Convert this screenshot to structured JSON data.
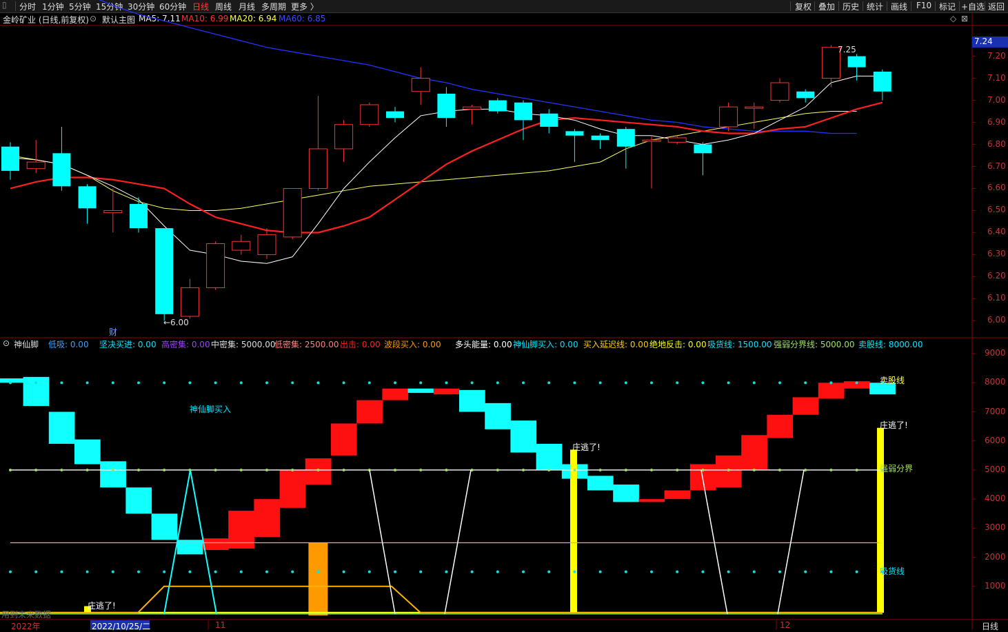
{
  "toolbar": {
    "periods": [
      "分时",
      "1分钟",
      "5分钟",
      "15分钟",
      "30分钟",
      "60分钟",
      "日线",
      "周线",
      "月线",
      "多周期",
      "更多 〉"
    ],
    "active_period": "日线",
    "tools": [
      "复权",
      "叠加",
      "历史",
      "统计",
      "画线",
      "F10",
      "标记",
      "+自选",
      "返回"
    ]
  },
  "main_info": {
    "stock": "金岭矿业 (日线,前复权)",
    "indicator": "默认主图",
    "ma5_label": "MA5: 7.11",
    "ma10_label": "MA10: 6.99",
    "ma20_label": "MA20: 6.94",
    "ma60_label": "MA60: 6.85"
  },
  "colors": {
    "up": "#ff3333",
    "down": "#00ffff",
    "ma5": "#ffffff",
    "ma10": "#ff2020",
    "ma20": "#ffff66",
    "ma60": "#2233ff",
    "axis": "#c33",
    "grid": "#8a0000"
  },
  "price_axis": [
    "7.20",
    "7.10",
    "7.00",
    "6.90",
    "6.80",
    "6.70",
    "6.60",
    "6.50",
    "6.40",
    "6.30",
    "6.20",
    "6.10",
    "6.00"
  ],
  "price_current": "7.24",
  "annotations": {
    "high": "7.25",
    "low": "←6.00",
    "cai": "财",
    "sxj_buy": "神仙脚买入",
    "zhuang_1": "庄逃了!",
    "zhuang_2": "庄逃了!",
    "zhuang_3": "庄逃了!",
    "sell_line": "卖股线",
    "strong_weak": "强弱分界",
    "buy_line": "吸货线",
    "future_data": "用到未来数据"
  },
  "indicator_info": {
    "name": "神仙脚",
    "items": [
      {
        "label": "低吸: 0.00",
        "color": "#3aa0ff"
      },
      {
        "label": "坚决买进: 0.00",
        "color": "#00e5ff"
      },
      {
        "label": "高密集: 0.00",
        "color": "#a040ff"
      },
      {
        "label": "中密集: 5000.00",
        "color": "#dddddd"
      },
      {
        "label": "低密集: 2500.00",
        "color": "#ff8080"
      },
      {
        "label": "出击: 0.00",
        "color": "#ff2020"
      },
      {
        "label": "波段买入: 0.00",
        "color": "#ff9900"
      },
      {
        "label": "多头能量: 0.00",
        "color": "#ffffff"
      },
      {
        "label": "神仙脚买入: 0.00",
        "color": "#00e5ff"
      },
      {
        "label": "买入延迟线: 0.00",
        "color": "#ffcc00"
      },
      {
        "label": "绝地反击: 0.00",
        "color": "#ffff00"
      },
      {
        "label": "吸货线: 1500.00",
        "color": "#00e5ff"
      },
      {
        "label": "强弱分界线: 5000.00",
        "color": "#a0e060"
      },
      {
        "label": "卖股线: 8000.00",
        "color": "#00e5ff"
      }
    ]
  },
  "ind_axis": [
    "9000",
    "8000",
    "7000",
    "6000",
    "5000",
    "4000",
    "3000",
    "2000",
    "1000"
  ],
  "date_axis": {
    "year": "2022年",
    "date": "2022/10/25/二",
    "m11": "11",
    "m12": "12",
    "period": "日线"
  },
  "chart_data": {
    "type": "candlestick",
    "candles": [
      [
        6.79,
        6.68,
        6.81,
        6.64
      ],
      [
        6.69,
        6.72,
        6.82,
        6.67
      ],
      [
        6.76,
        6.61,
        6.88,
        6.59
      ],
      [
        6.61,
        6.51,
        6.62,
        6.44
      ],
      [
        6.49,
        6.5,
        6.6,
        6.4
      ],
      [
        6.53,
        6.42,
        6.56,
        6.4
      ],
      [
        6.42,
        6.03,
        6.42,
        6.0
      ],
      [
        6.02,
        6.15,
        6.19,
        6.01
      ],
      [
        6.15,
        6.35,
        6.36,
        6.14
      ],
      [
        6.32,
        6.36,
        6.39,
        6.3
      ],
      [
        6.3,
        6.39,
        6.42,
        6.28
      ],
      [
        6.38,
        6.6,
        6.6,
        6.37
      ],
      [
        6.6,
        6.78,
        7.02,
        6.59
      ],
      [
        6.78,
        6.89,
        6.91,
        6.72
      ],
      [
        6.89,
        6.98,
        6.99,
        6.88
      ],
      [
        6.95,
        6.92,
        6.97,
        6.9
      ],
      [
        7.04,
        7.1,
        7.15,
        6.98
      ],
      [
        7.03,
        6.92,
        7.06,
        6.88
      ],
      [
        6.96,
        6.97,
        6.98,
        6.89
      ],
      [
        7.0,
        6.95,
        7.01,
        6.94
      ],
      [
        6.99,
        6.91,
        7.0,
        6.82
      ],
      [
        6.94,
        6.88,
        6.96,
        6.85
      ],
      [
        6.86,
        6.84,
        6.87,
        6.72
      ],
      [
        6.84,
        6.82,
        6.85,
        6.78
      ],
      [
        6.87,
        6.79,
        6.88,
        6.69
      ],
      [
        6.82,
        6.82,
        6.84,
        6.6
      ],
      [
        6.81,
        6.83,
        6.84,
        6.8
      ],
      [
        6.8,
        6.76,
        6.81,
        6.66
      ],
      [
        6.88,
        6.97,
        6.99,
        6.86
      ],
      [
        6.97,
        6.97,
        6.99,
        6.87
      ],
      [
        7.0,
        7.08,
        7.1,
        6.99
      ],
      [
        7.04,
        7.01,
        7.05,
        6.99
      ],
      [
        7.1,
        7.24,
        7.25,
        7.06
      ],
      [
        7.2,
        7.15,
        7.21,
        7.09
      ],
      [
        7.13,
        7.04,
        7.14,
        7.0
      ]
    ],
    "ma5": [
      6.74,
      6.73,
      6.71,
      6.66,
      6.61,
      6.55,
      6.43,
      6.32,
      6.3,
      6.27,
      6.26,
      6.29,
      6.44,
      6.6,
      6.72,
      6.83,
      6.93,
      6.95,
      6.96,
      6.96,
      6.94,
      6.93,
      6.91,
      6.87,
      6.84,
      6.84,
      6.82,
      6.8,
      6.82,
      6.85,
      6.91,
      6.97,
      7.08,
      7.11,
      7.11
    ],
    "ma10": [
      6.6,
      6.63,
      6.65,
      6.65,
      6.64,
      6.62,
      6.6,
      6.53,
      6.47,
      6.44,
      6.41,
      6.4,
      6.4,
      6.43,
      6.47,
      6.55,
      6.63,
      6.71,
      6.77,
      6.82,
      6.87,
      6.91,
      6.92,
      6.91,
      6.9,
      6.89,
      6.88,
      6.86,
      6.85,
      6.85,
      6.87,
      6.88,
      6.92,
      6.96,
      6.99
    ],
    "ma20": [
      6.75,
      6.73,
      6.71,
      6.66,
      6.59,
      6.54,
      6.51,
      6.5,
      6.5,
      6.51,
      6.53,
      6.55,
      6.57,
      6.59,
      6.61,
      6.62,
      6.63,
      6.64,
      6.65,
      6.66,
      6.67,
      6.68,
      6.7,
      6.72,
      6.78,
      6.82,
      6.84,
      6.86,
      6.88,
      6.9,
      6.92,
      6.94,
      6.95,
      6.95
    ],
    "ma60": [
      7.6,
      7.57,
      7.53,
      7.48,
      7.43,
      7.39,
      7.36,
      7.33,
      7.3,
      7.27,
      7.24,
      7.22,
      7.2,
      7.18,
      7.16,
      7.13,
      7.1,
      7.08,
      7.05,
      7.03,
      7.01,
      6.99,
      6.97,
      6.95,
      6.93,
      6.91,
      6.9,
      6.88,
      6.87,
      6.86,
      6.86,
      6.86,
      6.85,
      6.85
    ],
    "ylim": [
      5.97,
      7.33
    ],
    "indicator": {
      "ylim": [
        0,
        9500
      ],
      "blocks": [
        [
          8150,
          8000
        ],
        [
          8200,
          7200
        ],
        [
          7000,
          5900
        ],
        [
          6050,
          5200
        ],
        [
          5300,
          4400
        ],
        [
          4400,
          3500
        ],
        [
          3500,
          2600
        ],
        [
          2600,
          2100
        ],
        [
          2250,
          2650
        ],
        [
          2300,
          3600
        ],
        [
          2700,
          4000
        ],
        [
          3700,
          5000
        ],
        [
          4500,
          5400
        ],
        [
          5500,
          6600
        ],
        [
          6600,
          7400
        ],
        [
          7400,
          7800
        ],
        [
          7800,
          7650
        ],
        [
          7600,
          7800
        ],
        [
          7750,
          7000
        ],
        [
          7300,
          6400
        ],
        [
          6700,
          5600
        ],
        [
          5900,
          5000
        ],
        [
          5200,
          4700
        ],
        [
          4800,
          4300
        ],
        [
          4500,
          3900
        ],
        [
          3900,
          4000
        ],
        [
          4000,
          4300
        ],
        [
          4300,
          5200
        ],
        [
          4400,
          5500
        ],
        [
          5000,
          6200
        ],
        [
          6100,
          6900
        ],
        [
          6900,
          7500
        ],
        [
          7450,
          8000
        ],
        [
          7800,
          8050
        ],
        [
          8000,
          7600
        ]
      ],
      "sxj_peaks": [
        7
      ],
      "yellow_bars": [
        3300,
        4050
      ],
      "orange_bar": [
        2500,
        12
      ],
      "dotted_levels": [
        8000,
        1500
      ],
      "strong_weak": 5000,
      "low_line": 2500,
      "delay_line": [
        [
          5,
          0
        ],
        [
          6,
          1000
        ],
        [
          14,
          1000
        ],
        [
          16,
          0
        ]
      ],
      "white_lines": [
        [
          14,
          0
        ],
        [
          15,
          5000
        ],
        [
          17,
          0
        ],
        [
          18,
          5000
        ],
        [
          27,
          0
        ],
        [
          28,
          5000
        ],
        [
          31,
          0
        ],
        [
          32,
          5000
        ]
      ]
    }
  }
}
